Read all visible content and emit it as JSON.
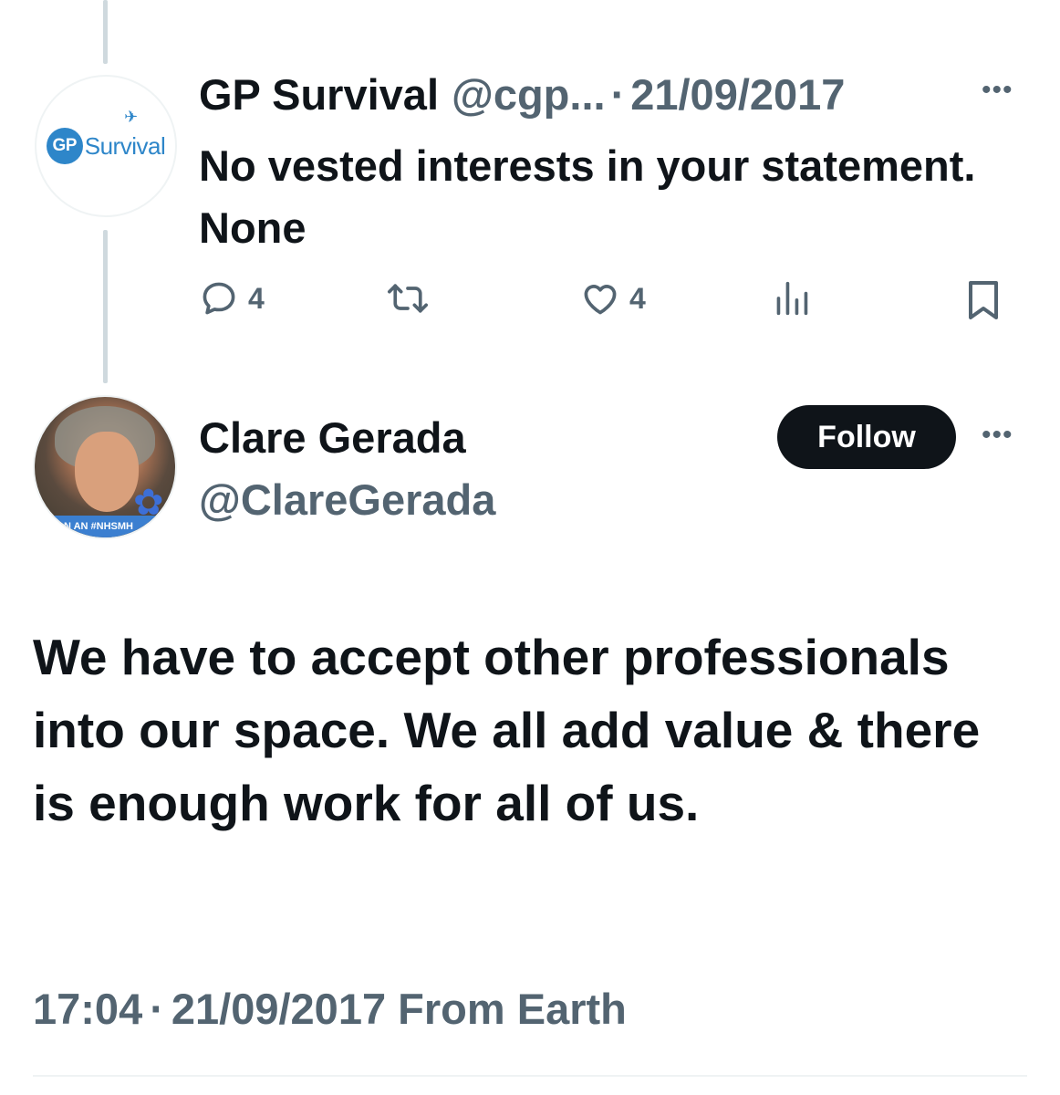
{
  "tweet1": {
    "name": "GP Survival",
    "handle": "@cgp...",
    "separator": "·",
    "date": "21/09/2017",
    "text": "No vested interests in your statement. None",
    "avatar": {
      "logo_badge": "GP",
      "logo_word": "Survival"
    },
    "actions": {
      "reply_count": "4",
      "like_count": "4"
    }
  },
  "tweet2": {
    "name": "Clare Gerada",
    "handle": "@ClareGerada",
    "follow_label": "Follow",
    "avatar_banner": "N AN #NHSMH",
    "text": "We have to accept other professionals into our space. We all add value & there is enough work for all of us.",
    "time": "17:04",
    "separator": "·",
    "date": "21/09/2017",
    "source": "From Earth"
  },
  "icons": {
    "more": "more-horizontal-icon",
    "reply": "reply-icon",
    "retweet": "retweet-icon",
    "like": "heart-icon",
    "views": "views-icon",
    "bookmark": "bookmark-icon"
  },
  "colors": {
    "primary_text": "#0f1419",
    "secondary_text": "#536471",
    "thread_line": "#cfd9de",
    "follow_button_bg": "#0f1419",
    "gp_brand": "#2e86c9"
  }
}
